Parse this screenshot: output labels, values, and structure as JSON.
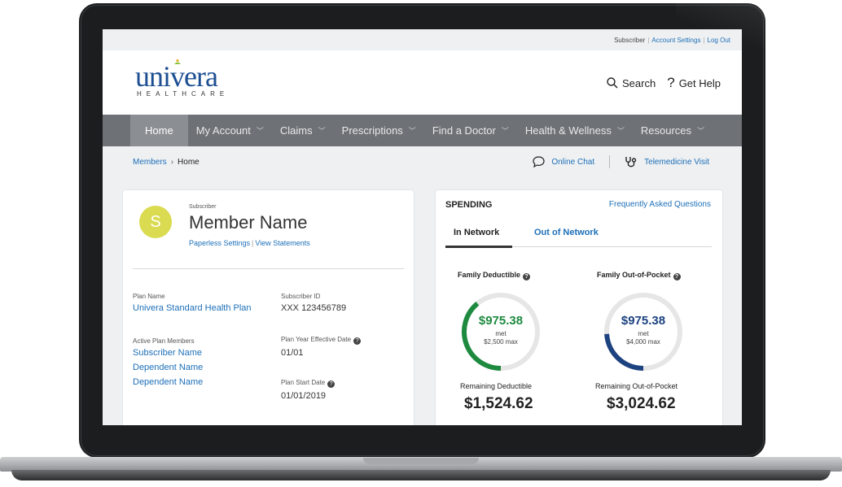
{
  "topbar": {
    "role": "Subscriber",
    "settings": "Account Settings",
    "logout": "Log Out"
  },
  "brand": {
    "name": "univera",
    "sub": "HEALTHCARE",
    "color": "#1d4f92"
  },
  "header": {
    "search": "Search",
    "help": "Get Help",
    "search_icon": "search-icon",
    "help_icon": "question-icon"
  },
  "nav": [
    {
      "label": "Home",
      "active": true
    },
    {
      "label": "My Account"
    },
    {
      "label": "Claims"
    },
    {
      "label": "Prescriptions"
    },
    {
      "label": "Find a Doctor"
    },
    {
      "label": "Health & Wellness"
    },
    {
      "label": "Resources"
    }
  ],
  "breadcrumb": {
    "root": "Members",
    "current": "Home"
  },
  "subactions": {
    "chat": "Online Chat",
    "telemed": "Telemedicine Visit"
  },
  "member": {
    "initial": "S",
    "role": "Subscriber",
    "name": "Member Name",
    "paperless": "Paperless Settings",
    "statements": "View Statements"
  },
  "plan": {
    "plan_name_label": "Plan Name",
    "plan_name": "Univera Standard Health Plan",
    "subscriber_id_label": "Subscriber ID",
    "subscriber_id": "XXX 123456789",
    "members_label": "Active Plan Members",
    "members": [
      "Subscriber Name",
      "Dependent Name",
      "Dependent Name"
    ],
    "effective_label": "Plan Year Effective Date",
    "effective": "01/01",
    "start_label": "Plan Start Date",
    "start": "01/01/2019"
  },
  "spending": {
    "title": "SPENDING",
    "faq": "Frequently Asked Questions",
    "tabs": [
      "In Network",
      "Out of Network"
    ],
    "deductible": {
      "label": "Family Deductible",
      "met": "$975.38",
      "met_word": "met",
      "max": "$2,500 max",
      "met_fraction": 0.39,
      "color": "#1e8a3f",
      "remaining_label": "Remaining Deductible",
      "remaining": "$1,524.62"
    },
    "oop": {
      "label": "Family Out-of-Pocket",
      "met": "$975.38",
      "met_word": "met",
      "max": "$4,000 max",
      "met_fraction": 0.24,
      "color": "#1d4280",
      "remaining_label": "Remaining Out-of-Pocket",
      "remaining": "$3,024.62"
    }
  }
}
